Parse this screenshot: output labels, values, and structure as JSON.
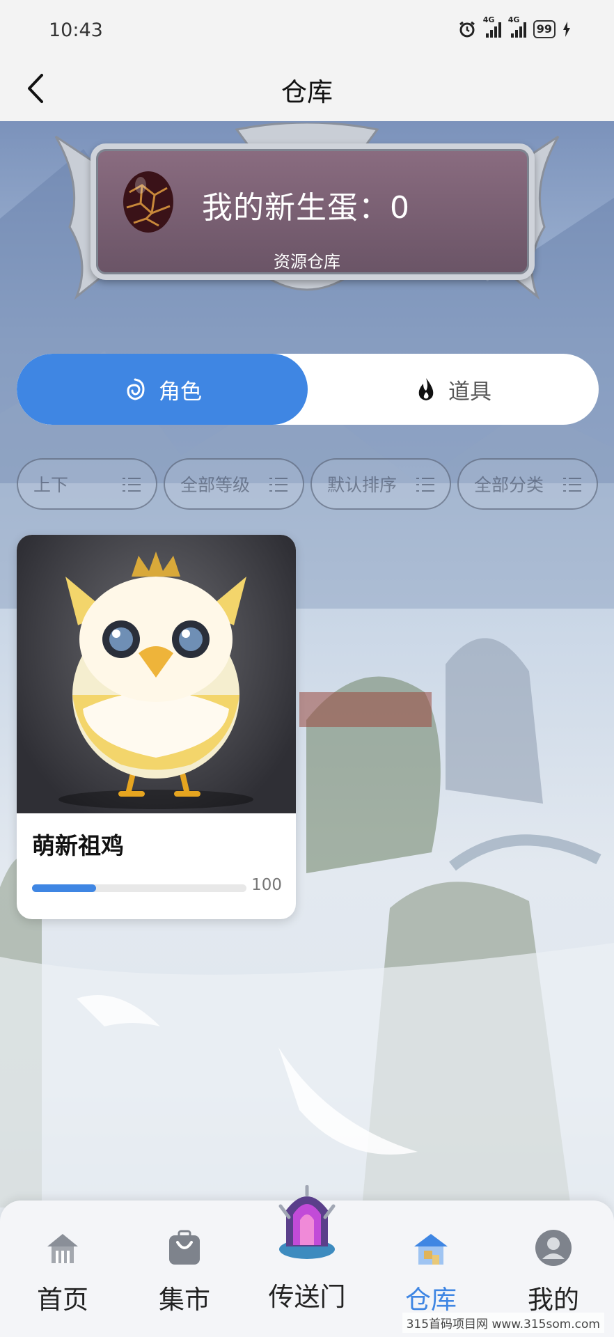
{
  "status_bar": {
    "time": "10:43",
    "network_1": "4G",
    "network_2": "4G",
    "battery": "99"
  },
  "nav": {
    "title": "仓库"
  },
  "banner": {
    "title": "我的新生蛋：0",
    "subtitle": "资源仓库"
  },
  "tabs": [
    {
      "label": "角色",
      "active": true
    },
    {
      "label": "道具",
      "active": false
    }
  ],
  "filters": [
    {
      "label": "上下"
    },
    {
      "label": "全部等级"
    },
    {
      "label": "默认排序"
    },
    {
      "label": "全部分类"
    }
  ],
  "items": [
    {
      "name": "萌新祖鸡",
      "progress_value": "100",
      "progress_fraction": 0.3
    }
  ],
  "bottom_nav": [
    {
      "label": "首页"
    },
    {
      "label": "集市"
    },
    {
      "label": "传送门"
    },
    {
      "label": "仓库",
      "active": true
    },
    {
      "label": "我的"
    }
  ],
  "watermark": "315首码项目网 www.315som.com",
  "colors": {
    "accent": "#3f86e3"
  }
}
